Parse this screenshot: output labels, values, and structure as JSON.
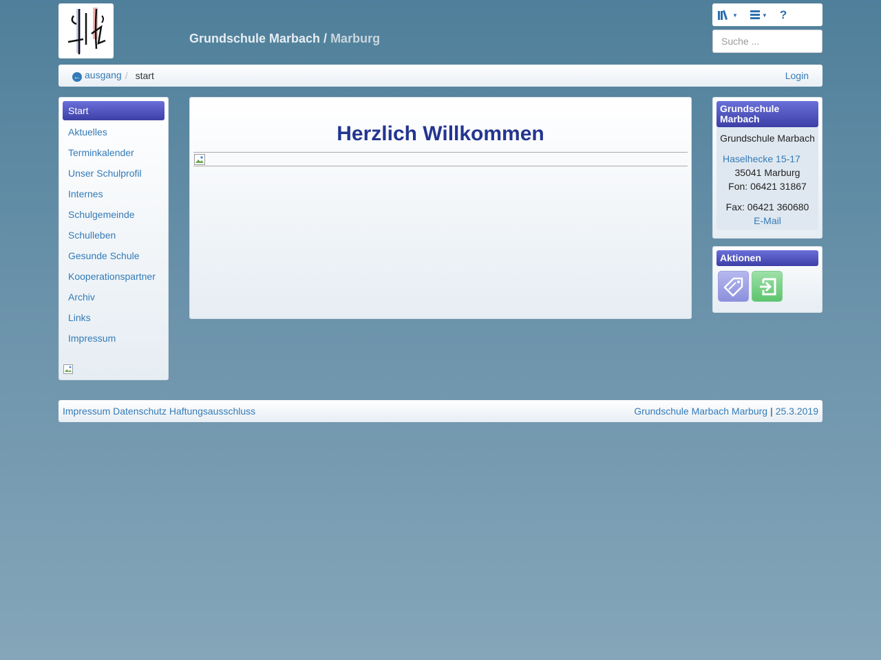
{
  "header": {
    "school_name": "Grundschule Marbach",
    "separator": " / ",
    "city": "Marburg",
    "toolbar_icons": [
      "library-icon",
      "list-icon",
      "help-icon"
    ],
    "help_glyph": "?",
    "search_placeholder": "Suche ..."
  },
  "breadcrumb": {
    "back_label": "ausgang",
    "separator": "/",
    "current": "start",
    "login": "Login"
  },
  "sidebar": {
    "items": [
      {
        "label": "Start",
        "active": true
      },
      {
        "label": "Aktuelles"
      },
      {
        "label": "Terminkalender"
      },
      {
        "label": "Unser Schulprofil"
      },
      {
        "label": "Internes"
      },
      {
        "label": "Schulgemeinde"
      },
      {
        "label": "Schulleben"
      },
      {
        "label": "Gesunde Schule"
      },
      {
        "label": "Kooperationspartner"
      },
      {
        "label": "Archiv"
      },
      {
        "label": "Links"
      },
      {
        "label": "Impressum"
      }
    ]
  },
  "main": {
    "heading": "Herzlich Willkommen"
  },
  "contact": {
    "title": "Grundschule Marbach",
    "name": "Grundschule Marbach",
    "street": "Haselhecke 15-17",
    "city": "35041 Marburg",
    "phone": "Fon: 06421 31867",
    "fax": "Fax: 06421 360680",
    "email": "E-Mail"
  },
  "actions": {
    "title": "Aktionen",
    "buttons": [
      "tag-icon",
      "login-icon"
    ]
  },
  "footer": {
    "impressum": "Impressum",
    "datenschutz": "Datenschutz",
    "haftung": "Haftungsausschluss",
    "school_link": "Grundschule Marbach Marburg",
    "pipe": "|",
    "date": "25.3.2019"
  },
  "colors": {
    "accent": "#3c3fa6",
    "link": "#337ab7",
    "heading": "#23358f"
  }
}
